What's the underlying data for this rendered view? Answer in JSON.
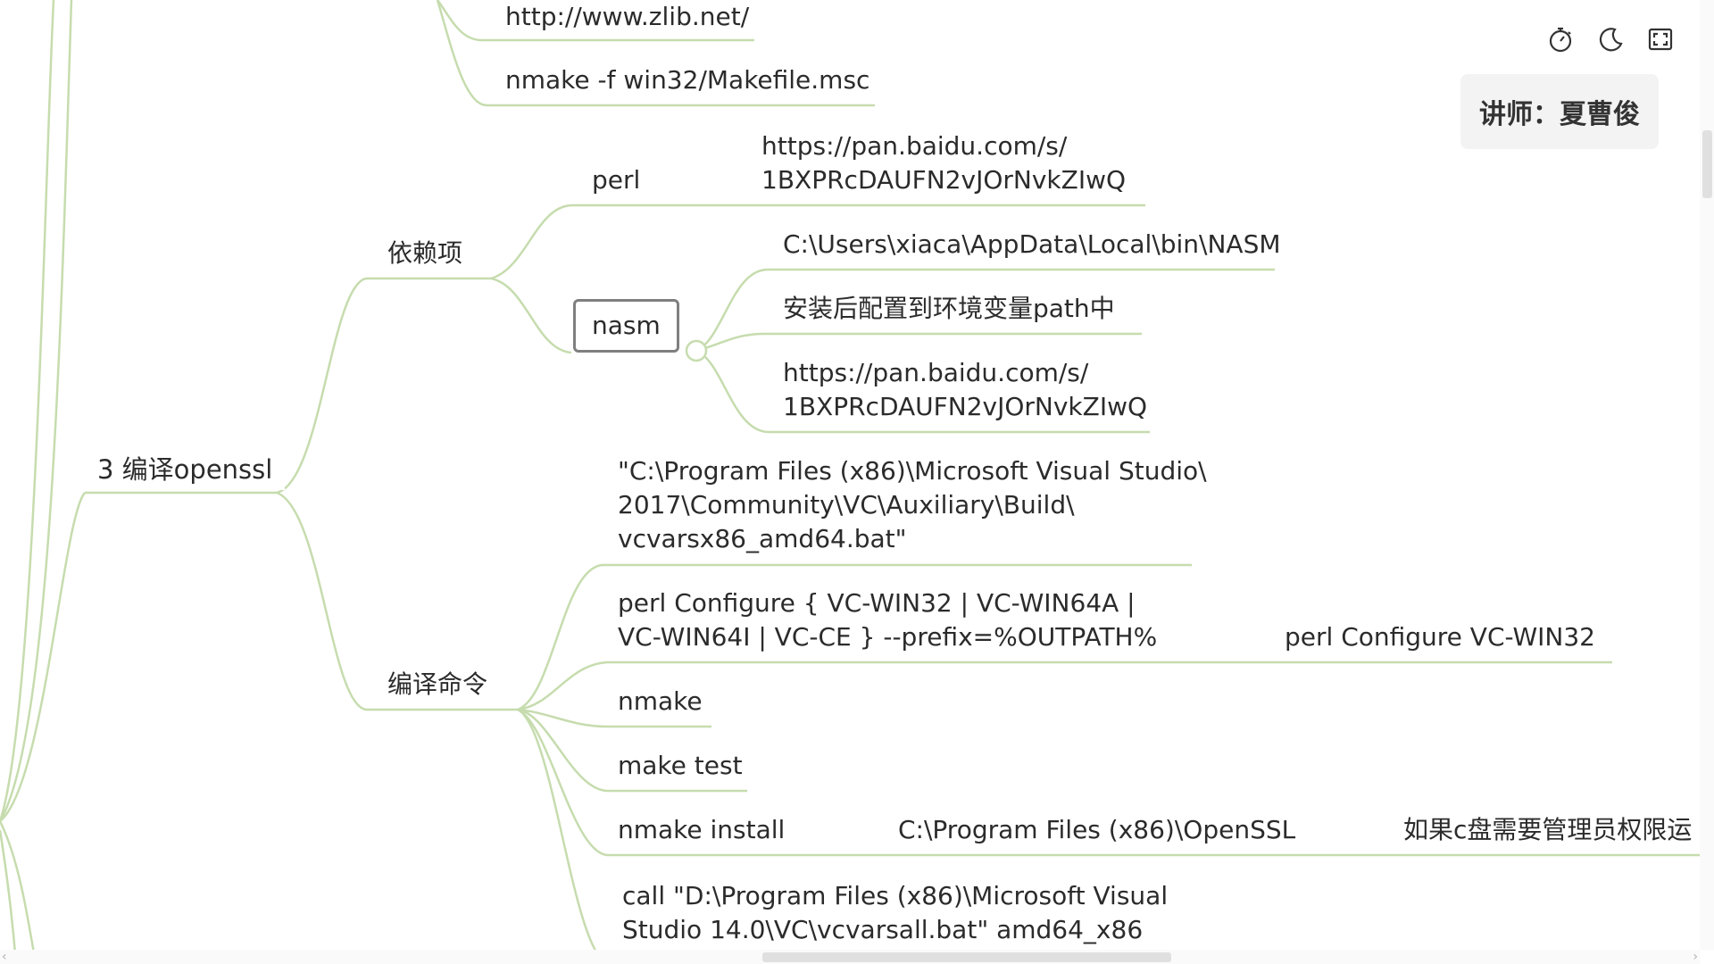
{
  "nodes": {
    "zlib_url": "http://www.zlib.net/",
    "nmake_makefile": "nmake -f win32/Makefile.msc",
    "central": "3 编译openssl",
    "deps": "依赖项",
    "perl": "perl",
    "perl_url": [
      "https://pan.baidu.com/s/",
      "1BXPRcDAUFN2vJOrNvkZIwQ"
    ],
    "nasm": "nasm",
    "nasm_path": "C:\\Users\\xiaca\\AppData\\Local\\bin\\NASM",
    "nasm_env": "安装后配置到环境变量path中",
    "nasm_url": [
      "https://pan.baidu.com/s/",
      "1BXPRcDAUFN2vJOrNvkZIwQ"
    ],
    "build_cmds": "编译命令",
    "vcvars": [
      "\"C:\\Program Files (x86)\\Microsoft Visual Studio\\",
      "2017\\Community\\VC\\Auxiliary\\Build\\",
      "vcvarsx86_amd64.bat\""
    ],
    "perl_configure": [
      "perl Configure { VC-WIN32 | VC-WIN64A |",
      "VC-WIN64I | VC-CE } --prefix=%OUTPATH%"
    ],
    "perl_configure_example": "perl Configure  VC-WIN32",
    "nmake": "nmake",
    "make_test": "make test",
    "nmake_install": "nmake install",
    "install_path": "C:\\Program Files (x86)\\OpenSSL",
    "admin_note": "如果c盘需要管理员权限运",
    "call_vcvarsall": [
      "call \"D:\\Program Files (x86)\\Microsoft Visual",
      "Studio 14.0\\VC\\vcvarsall.bat\" amd64_x86"
    ]
  },
  "lecturer": "讲师：夏曹俊",
  "toolbar": {
    "timer_icon": "timer-icon",
    "theme_icon": "moon-icon",
    "fullscreen_icon": "fullscreen-icon"
  },
  "colors": {
    "branch": "#c6dcae",
    "text": "#2b2b2b",
    "selected_border": "#7f7f7f"
  }
}
